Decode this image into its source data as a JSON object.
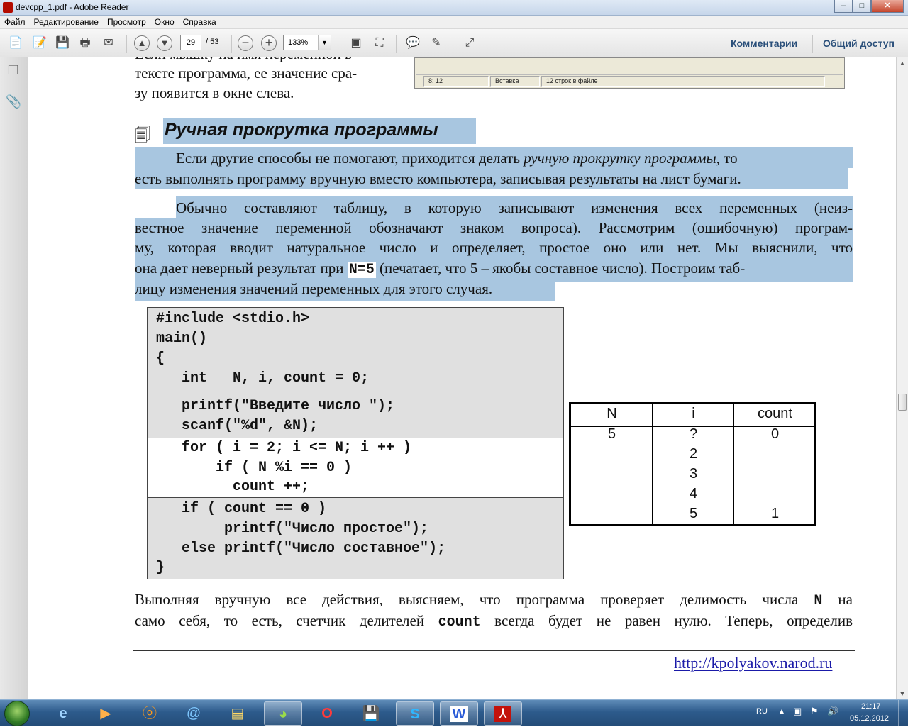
{
  "window": {
    "title": "devcpp_1.pdf - Adobe Reader",
    "minimize": "–",
    "maximize": "□",
    "close": "✕"
  },
  "menu": [
    "Файл",
    "Редактирование",
    "Просмотр",
    "Окно",
    "Справка"
  ],
  "toolbar": {
    "page_current": "29",
    "page_total": "/ 53",
    "zoom": "133%",
    "comments_label": "Комментарии",
    "share_label": "Общий доступ",
    "icons": [
      "create-icon",
      "edit-icon",
      "save-icon",
      "print-icon",
      "email-icon",
      "prev-page-icon",
      "next-page-icon",
      "zoom-out-icon",
      "zoom-in-icon",
      "fit-page-icon",
      "fit-width-icon",
      "comment-icon",
      "highlight-icon",
      "fullscreen-icon"
    ]
  },
  "document": {
    "top_lines": [
      "тексте программа, ее значение сра-",
      "зу появится в окне слева."
    ],
    "top_partial": "Если мышку на имя переменной в",
    "thumb_status": [
      "8: 12",
      "Вставка",
      "12 строк в файле"
    ],
    "heading": "Ручная прокрутка программы",
    "para1": {
      "line1_start": "Если другие способы не помогают, приходится делать ",
      "line1_italic": "ручную прокрутку программы",
      "line1_end": ", то",
      "line2": "есть выполнять программу вручную вместо компьютера, записывая результаты на лист бумаги."
    },
    "para2": {
      "line1": "Обычно составляют таблицу, в которую записывают изменения всех переменных (неиз-",
      "line2": "вестное значение переменной обозначают знаком вопроса). Рассмотрим (ошибочную) програм-",
      "line3": "му, которая вводит натуральное число и определяет, простое оно или нет. Мы выяснили, что",
      "line4_start": "она дает неверный результат при ",
      "line4_code": "N=5",
      "line4_end": " (печатает, что 5 – якобы составное число). Построим таб-",
      "line5": "лицу изменения значений переменных для этого случая."
    },
    "code": [
      "#include <stdio.h>",
      "main()",
      "{",
      "   int   N, i, count = 0;",
      "   printf(\"Введите число \");",
      "   scanf(\"%d\", &N);",
      "   for ( i = 2; i <= N; i ++ )",
      "       if ( N %i == 0 )",
      "         count ++;",
      "   if ( count == 0 )",
      "        printf(\"Число простое\");",
      "   else printf(\"Число составное\");",
      "}"
    ],
    "table": {
      "headers": [
        "N",
        "i",
        "count"
      ],
      "col_N": [
        "5",
        "",
        "",
        "",
        ""
      ],
      "col_i": [
        "?",
        "2",
        "3",
        "4",
        "5"
      ],
      "col_count": [
        "0",
        "",
        "",
        "",
        "1"
      ]
    },
    "para3": {
      "line1_start": "Выполняя вручную все действия, выясняем, что программа проверяет делимость числа ",
      "line1_code": "N",
      "line1_end": " на",
      "line2_start": "само себя, то есть, счетчик делителей ",
      "line2_code": "count",
      "line2_end": " всегда будет не равен нулю. Теперь, определив"
    },
    "footer_link": "http://kpolyakov.narod.ru"
  },
  "taskbar": {
    "apps": [
      "internet-explorer-icon",
      "media-player-icon",
      "odnoklassniki-icon",
      "mail-icon",
      "file-explorer-icon",
      "browser-icon",
      "opera-icon",
      "floppy-icon",
      "skype-icon",
      "word-icon",
      "adobe-reader-icon"
    ],
    "lang": "RU",
    "time": "21:17",
    "date": "05.12.2012"
  }
}
